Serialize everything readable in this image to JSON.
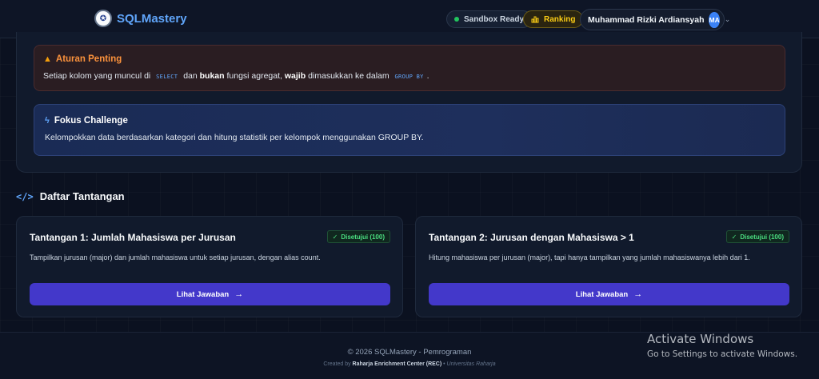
{
  "header": {
    "brand": "SQLMastery",
    "sandbox_label": "Sandbox Ready",
    "ranking_label": "Ranking",
    "user_name": "Muhammad Rizki Ardiansyah",
    "avatar_initials": "MA"
  },
  "rules": {
    "title": "Aturan Penting",
    "t1": "Setiap kolom yang muncul di",
    "code1": "SELECT",
    "t2": "dan",
    "b1": "bukan",
    "t3": "fungsi agregat,",
    "b2": "wajib",
    "t4": "dimasukkan ke dalam",
    "code2": "GROUP BY",
    "t5": "."
  },
  "focus": {
    "title": "Fokus Challenge",
    "text": "Kelompokkan data berdasarkan kategori dan hitung statistik per kelompok menggunakan GROUP BY."
  },
  "section": {
    "title": "Daftar Tantangan"
  },
  "challenges": [
    {
      "title": "Tantangan 1: Jumlah Mahasiswa per Jurusan",
      "badge": "Disetujui (100)",
      "desc": "Tampilkan jurusan (major) dan jumlah mahasiswa untuk setiap jurusan, dengan alias count.",
      "button": "Lihat Jawaban"
    },
    {
      "title": "Tantangan 2: Jurusan dengan Mahasiswa > 1",
      "badge": "Disetujui (100)",
      "desc": "Hitung mahasiswa per jurusan (major), tapi hanya tampilkan yang jumlah mahasiswanya lebih dari 1.",
      "button": "Lihat Jawaban"
    }
  ],
  "footer": {
    "copyright": "© 2026 SQLMastery - Pemrograman",
    "created_by": "Created by",
    "org": "Raharja Enrichment Center (REC)",
    "sep": "•",
    "uni": "Universitas Raharja"
  },
  "watermark": {
    "title": "Activate Windows",
    "subtitle": "Go to Settings to activate Windows."
  },
  "icons": {
    "logo": "university-seal-icon",
    "sandbox": "status-dot-icon",
    "ranking": "bar-chart-icon",
    "warning": "warning-triangle-icon",
    "focus": "lightning-bolt-icon",
    "section": "code-brackets-icon",
    "badge": "check-icon",
    "button": "arrow-right-icon"
  }
}
